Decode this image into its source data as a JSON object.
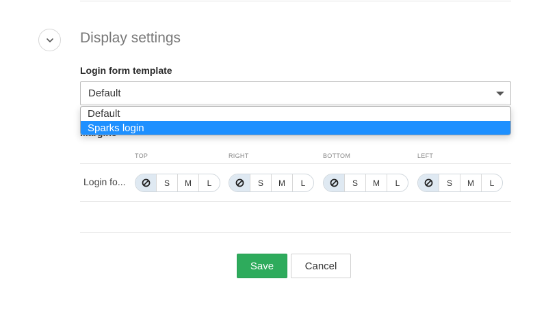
{
  "section": {
    "title": "Display settings",
    "collapse_icon": "chevron-down-icon"
  },
  "login_template": {
    "label": "Login form template",
    "selected_value": "Default",
    "options": [
      "Default",
      "Sparks login"
    ],
    "highlighted_option": "Sparks login"
  },
  "margins": {
    "label": "Margins",
    "columns": [
      "TOP",
      "RIGHT",
      "BOTTOM",
      "LEFT"
    ],
    "row_label": "Login fo...",
    "size_options": [
      "S",
      "M",
      "L"
    ],
    "none_icon": "no-symbol-icon"
  },
  "actions": {
    "save_label": "Save",
    "cancel_label": "Cancel"
  },
  "colors": {
    "accent_blue": "#1e90ff",
    "save_green": "#2eab5c",
    "seg_active_bg": "#dfe9f2"
  }
}
